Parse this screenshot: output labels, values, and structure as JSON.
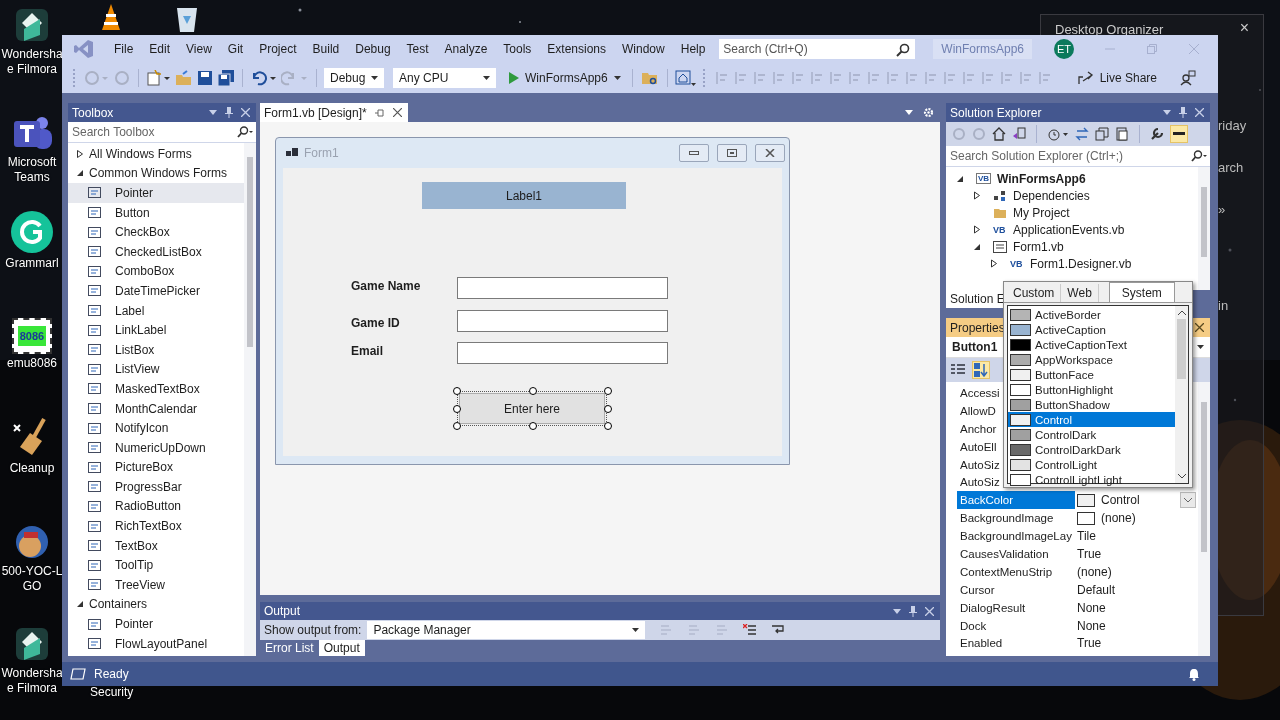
{
  "desktop": {
    "icons": [
      {
        "kind": "filmora",
        "label": [
          "Wondersha",
          "e Filmora"
        ]
      },
      {
        "kind": "teams",
        "label": [
          "Microsoft",
          "Teams"
        ]
      },
      {
        "kind": "grammarly",
        "label": [
          "Grammarl"
        ]
      },
      {
        "kind": "chip",
        "badge": "8086",
        "label": [
          "emu8086"
        ]
      },
      {
        "kind": "broom",
        "label": [
          "Cleanup"
        ]
      },
      {
        "kind": "medal",
        "label": [
          "500-YOC-L",
          "GO"
        ]
      },
      {
        "kind": "filmora",
        "label": [
          "Wondersha",
          "e Filmora"
        ]
      }
    ],
    "top_icons": [
      {
        "kind": "cone"
      },
      {
        "kind": "bin"
      }
    ],
    "hidden_label": "Security",
    "widget": {
      "title": "Desktop Organizer",
      "close": "×",
      "texts": [
        "riday",
        "arch",
        "»",
        "in"
      ]
    }
  },
  "menu": [
    "File",
    "Edit",
    "View",
    "Git",
    "Project",
    "Build",
    "Debug",
    "Test",
    "Analyze",
    "Tools",
    "Extensions",
    "Window",
    "Help"
  ],
  "search": {
    "placeholder": "Search (Ctrl+Q)"
  },
  "solution_name": "WinFormsApp6",
  "avatar": "ET",
  "toolbar": {
    "configuration": "Debug",
    "platform": "Any CPU",
    "run_target": "WinFormsApp6",
    "live_share": "Live Share"
  },
  "toolbox": {
    "title": "Toolbox",
    "search": {
      "placeholder": "Search Toolbox"
    },
    "groups": [
      {
        "label": "All Windows Forms",
        "expanded": false
      },
      {
        "label": "Common Windows Forms",
        "expanded": true,
        "children": [
          {
            "label": "Pointer",
            "selected": true
          },
          {
            "label": "Button",
            "selected": false
          },
          {
            "label": "CheckBox",
            "selected": false
          },
          {
            "label": "CheckedListBox",
            "selected": false
          },
          {
            "label": "ComboBox",
            "selected": false
          },
          {
            "label": "DateTimePicker",
            "selected": false
          },
          {
            "label": "Label",
            "selected": false
          },
          {
            "label": "LinkLabel",
            "selected": false
          },
          {
            "label": "ListBox",
            "selected": false
          },
          {
            "label": "ListView",
            "selected": false
          },
          {
            "label": "MaskedTextBox",
            "selected": false
          },
          {
            "label": "MonthCalendar",
            "selected": false
          },
          {
            "label": "NotifyIcon",
            "selected": false
          },
          {
            "label": "NumericUpDown",
            "selected": false
          },
          {
            "label": "PictureBox",
            "selected": false
          },
          {
            "label": "ProgressBar",
            "selected": false
          },
          {
            "label": "RadioButton",
            "selected": false
          },
          {
            "label": "RichTextBox",
            "selected": false
          },
          {
            "label": "TextBox",
            "selected": false
          },
          {
            "label": "ToolTip",
            "selected": false
          },
          {
            "label": "TreeView",
            "selected": false
          }
        ]
      },
      {
        "label": "Containers",
        "expanded": true,
        "children": [
          {
            "label": "Pointer",
            "selected": false
          },
          {
            "label": "FlowLayoutPanel",
            "selected": false
          }
        ]
      }
    ]
  },
  "document_tabs": [
    {
      "label": "Form1.vb [Design]*",
      "selected": true
    }
  ],
  "form": {
    "title": "Form1",
    "banner": "Label1",
    "fields": [
      {
        "label": "Game Name"
      },
      {
        "label": "Game ID"
      },
      {
        "label": "Email"
      }
    ],
    "button": {
      "label": "Enter here",
      "selected": true
    }
  },
  "output": {
    "title": "Output",
    "source_label": "Show output from:",
    "source": "Package Manager",
    "tabs": [
      {
        "label": "Error List",
        "selected": false
      },
      {
        "label": "Output",
        "selected": true
      }
    ]
  },
  "solution_explorer": {
    "title": "Solution Explorer",
    "search": {
      "placeholder": "Search Solution Explorer (Ctrl+;)"
    },
    "tree": [
      {
        "label": "WinFormsApp6",
        "kind": "project",
        "badge": "VB",
        "expanded": true,
        "children": [
          {
            "label": "Dependencies",
            "kind": "dependencies",
            "expanded": false
          },
          {
            "label": "My Project",
            "kind": "folder"
          },
          {
            "label": "ApplicationEvents.vb",
            "kind": "vbfile",
            "badge": "VB",
            "expanded": false
          },
          {
            "label": "Form1.vb",
            "kind": "form",
            "expanded": true,
            "children": [
              {
                "label": "Form1.Designer.vb",
                "kind": "vbfile",
                "badge": "VB",
                "expanded": false
              }
            ]
          }
        ]
      }
    ],
    "tab": "Solution E"
  },
  "properties": {
    "title": "Properties",
    "object": "Button1",
    "rows": [
      {
        "name": "Accessi",
        "selected": false
      },
      {
        "name": "AllowD",
        "selected": false
      },
      {
        "name": "Anchor",
        "selected": false
      },
      {
        "name": "AutoEll",
        "selected": false
      },
      {
        "name": "AutoSiz",
        "selected": false
      },
      {
        "name": "AutoSiz",
        "selected": false
      },
      {
        "name": "BackColor",
        "value": "Control",
        "color": "#f0f0f0",
        "dropdown": true,
        "selected": true
      },
      {
        "name": "BackgroundImage",
        "value": "(none)",
        "color": "#ffffff",
        "selected": false
      },
      {
        "name": "BackgroundImageLay",
        "value": "Tile",
        "selected": false
      },
      {
        "name": "CausesValidation",
        "value": "True",
        "selected": false
      },
      {
        "name": "ContextMenuStrip",
        "value": "(none)",
        "selected": false
      },
      {
        "name": "Cursor",
        "value": "Default",
        "selected": false
      },
      {
        "name": "DialogResult",
        "value": "None",
        "selected": false
      },
      {
        "name": "Dock",
        "value": "None",
        "selected": false
      },
      {
        "name": "Enabled",
        "value": "True",
        "selected": false
      }
    ]
  },
  "color_picker": {
    "tabs": [
      {
        "label": "Custom",
        "selected": false
      },
      {
        "label": "Web",
        "selected": false
      },
      {
        "label": "System",
        "selected": true
      }
    ],
    "items": [
      {
        "name": "ActiveBorder",
        "color": "#b4b4b4",
        "selected": false
      },
      {
        "name": "ActiveCaption",
        "color": "#99b4d1",
        "selected": false
      },
      {
        "name": "ActiveCaptionText",
        "color": "#000000",
        "selected": false
      },
      {
        "name": "AppWorkspace",
        "color": "#ababab",
        "selected": false
      },
      {
        "name": "ButtonFace",
        "color": "#f0f0f0",
        "selected": false
      },
      {
        "name": "ButtonHighlight",
        "color": "#ffffff",
        "selected": false
      },
      {
        "name": "ButtonShadow",
        "color": "#a0a0a0",
        "selected": false
      },
      {
        "name": "Control",
        "color": "#f0f0f0",
        "selected": true
      },
      {
        "name": "ControlDark",
        "color": "#a0a0a0",
        "selected": false
      },
      {
        "name": "ControlDarkDark",
        "color": "#696969",
        "selected": false
      },
      {
        "name": "ControlLight",
        "color": "#e3e3e3",
        "selected": false
      },
      {
        "name": "ControlLightLight",
        "color": "#ffffff",
        "selected": false
      }
    ]
  },
  "status_bar": {
    "text": "Ready"
  }
}
